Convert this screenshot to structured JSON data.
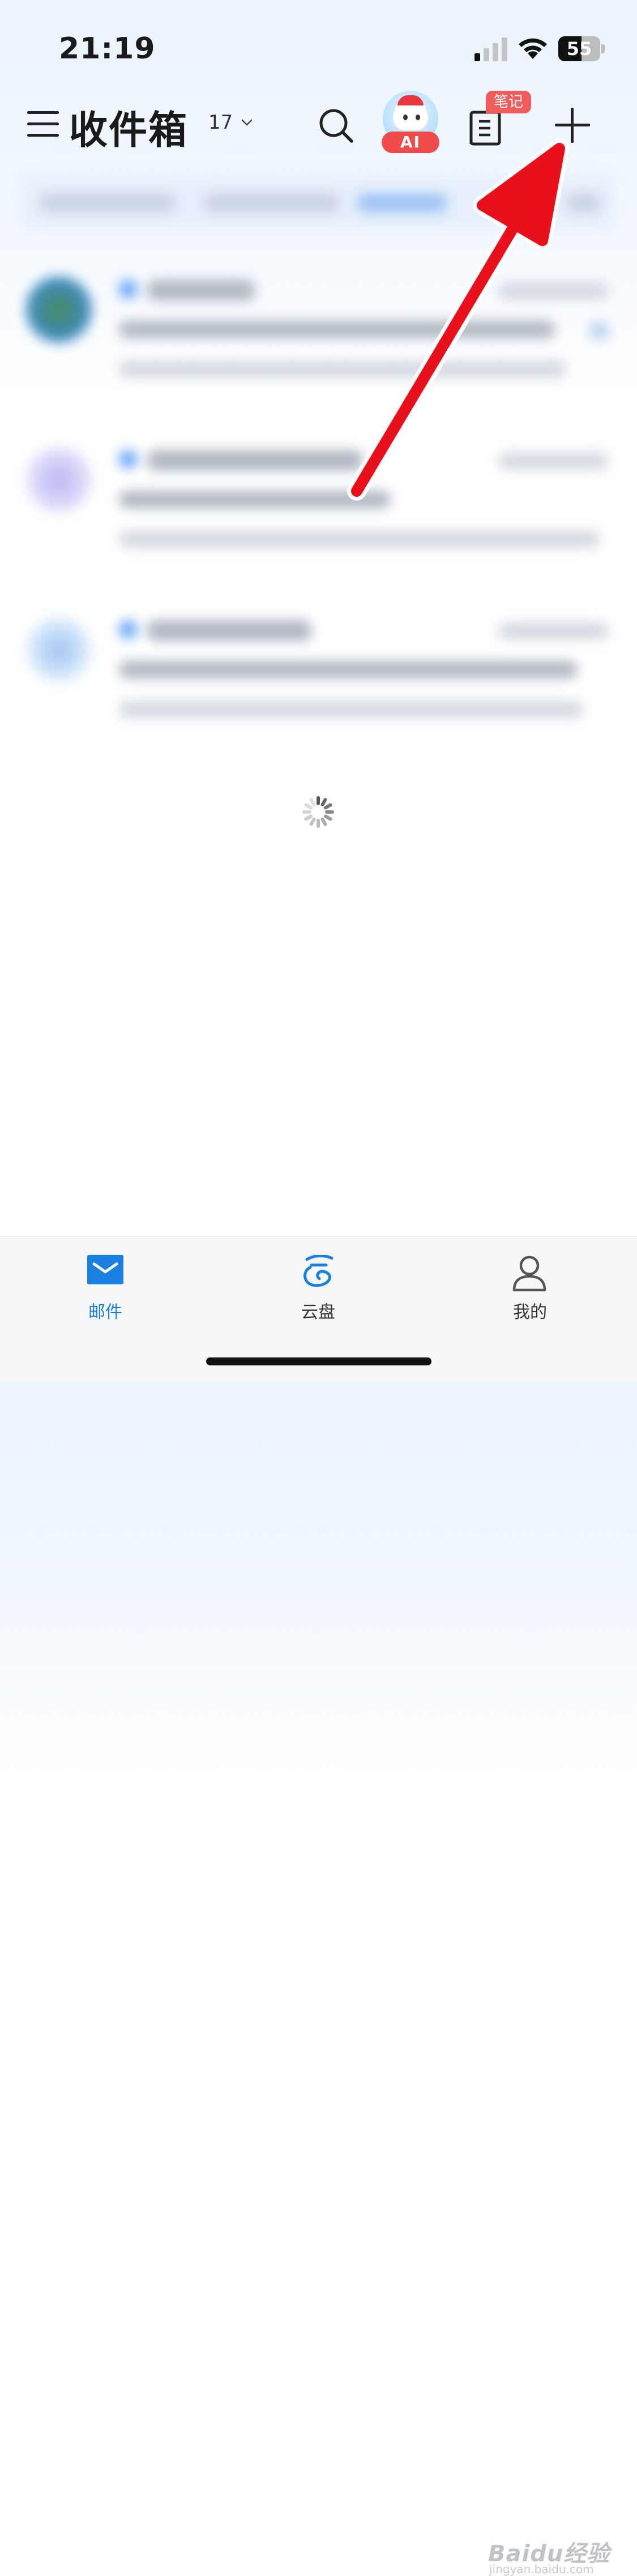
{
  "status_bar": {
    "time": "21:19",
    "battery_level": "55",
    "battery_fraction": 0.55
  },
  "header": {
    "title": "收件箱",
    "unread_count": "17",
    "ai_badge": "AI",
    "notes_badge": "笔记"
  },
  "tabs": [
    {
      "label": "邮件",
      "icon": "mail-icon",
      "active": true,
      "color": "#1a7fe0"
    },
    {
      "label": "云盘",
      "icon": "cloud-drive-icon",
      "active": false,
      "color": "#333333"
    },
    {
      "label": "我的",
      "icon": "profile-icon",
      "active": false,
      "color": "#333333"
    }
  ],
  "colors": {
    "accent": "#1a7fe0",
    "annotation_arrow": "#e8101a",
    "badge_red": "#f15b5b"
  },
  "watermark": {
    "brand": "Baidu经验",
    "url": "jingyan.baidu.com"
  }
}
